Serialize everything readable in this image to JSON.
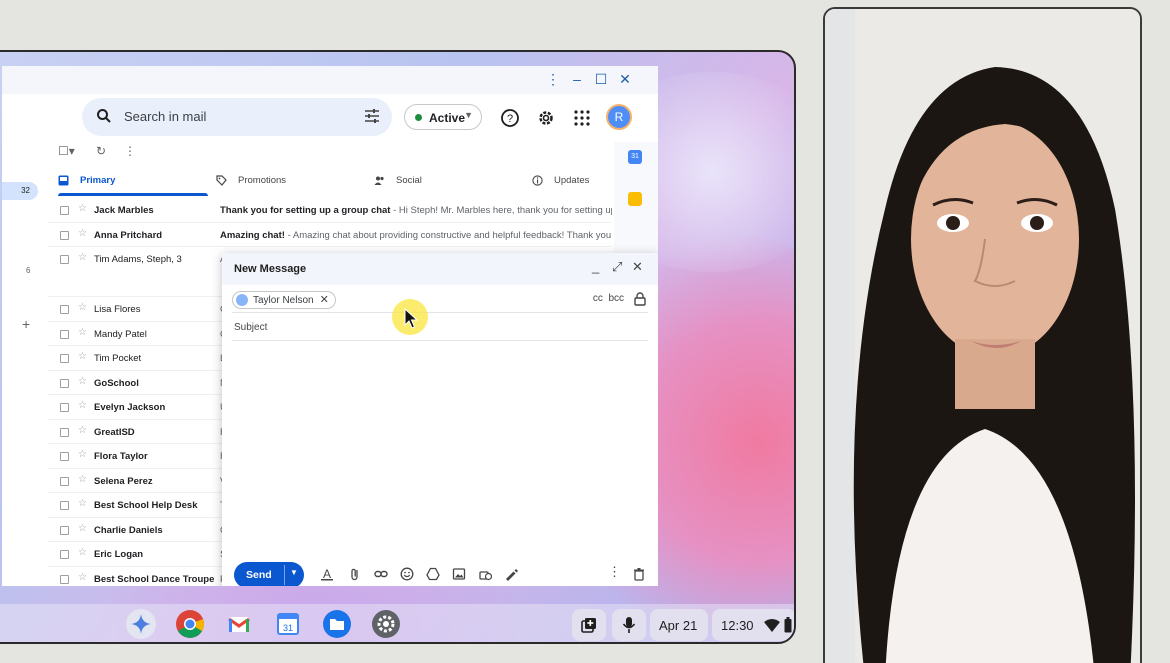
{
  "gmail": {
    "search": {
      "placeholder": "Search in mail"
    },
    "status": {
      "label": "Active"
    },
    "avatar_initial": "R",
    "rail": {
      "badge": "32",
      "count": "6"
    },
    "tabs": [
      {
        "label": "Primary",
        "icon": "inbox-icon"
      },
      {
        "label": "Promotions",
        "icon": "tag-icon"
      },
      {
        "label": "Social",
        "icon": "people-icon"
      },
      {
        "label": "Updates",
        "icon": "info-icon"
      }
    ],
    "emails": [
      {
        "sender": "Jack Marbles",
        "subject": "Thank you for setting up a group chat",
        "snippet": " - Hi Steph! Mr. Marbles here, thank you for setting up a gro",
        "unread": true
      },
      {
        "sender": "Anna Pritchard",
        "subject": "Amazing chat!",
        "snippet": " - Amazing chat about providing constructive and helpful feedback! Thank you Steph",
        "unread": true
      },
      {
        "sender": "Tim Adams, Steph, 3",
        "subject": "",
        "snippet": "A",
        "unread": false
      },
      {
        "sender": "Lisa Flores",
        "subject": "",
        "snippet": "C",
        "unread": false
      },
      {
        "sender": "Mandy Patel",
        "subject": "",
        "snippet": "C",
        "unread": false
      },
      {
        "sender": "Tim Pocket",
        "subject": "",
        "snippet": "L",
        "unread": false
      },
      {
        "sender": "GoSchool",
        "subject": "",
        "snippet": "N",
        "unread": true
      },
      {
        "sender": "Evelyn Jackson",
        "subject": "",
        "snippet": "U",
        "unread": true
      },
      {
        "sender": "GreatISD",
        "subject": "",
        "snippet": "F",
        "unread": true
      },
      {
        "sender": "Flora Taylor",
        "subject": "",
        "snippet": "F",
        "unread": true
      },
      {
        "sender": "Selena Perez",
        "subject": "",
        "snippet": "V",
        "unread": true
      },
      {
        "sender": "Best School Help Desk",
        "subject": "",
        "snippet": "T",
        "unread": true
      },
      {
        "sender": "Charlie Daniels",
        "subject": "",
        "snippet": "C",
        "unread": true
      },
      {
        "sender": "Eric Logan",
        "subject": "",
        "snippet": "S",
        "unread": true
      },
      {
        "sender": "Best School Dance Troupe",
        "subject": "",
        "snippet": "P",
        "unread": true
      }
    ]
  },
  "compose": {
    "title": "New Message",
    "recipient": "Taylor Nelson",
    "cc": "cc",
    "bcc": "bcc",
    "subject_placeholder": "Subject",
    "send_label": "Send"
  },
  "shelf": {
    "date": "Apr 21",
    "time": "12:30",
    "apps": [
      "gemini-icon",
      "chrome-icon",
      "gmail-icon",
      "calendar-icon",
      "files-icon",
      "settings-icon"
    ]
  },
  "colors": {
    "accent": "#0b57d0",
    "active_status": "#1e8e3e",
    "highlight": "#f9e43c"
  }
}
